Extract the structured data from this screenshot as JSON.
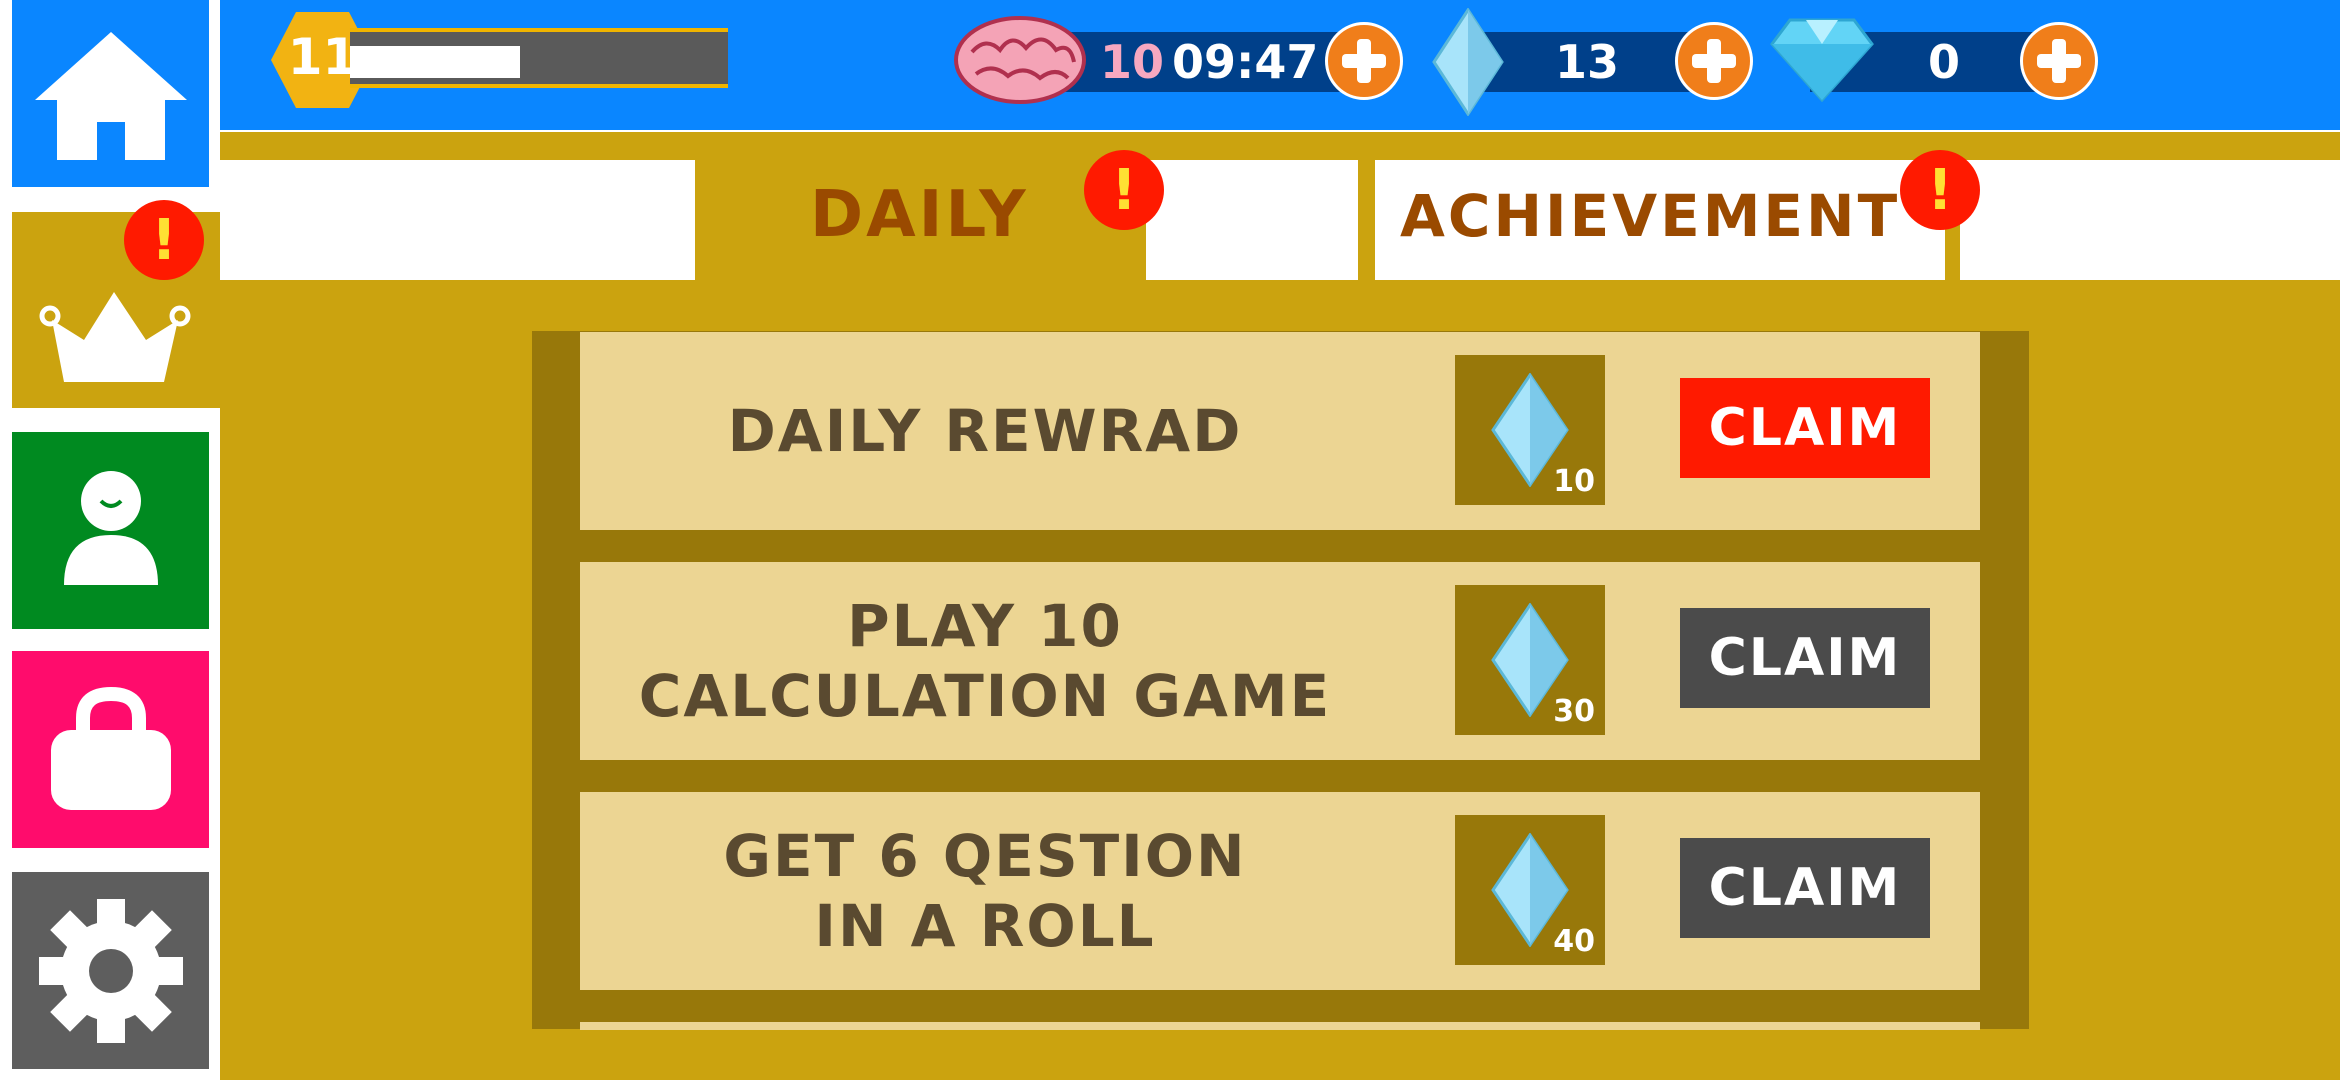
{
  "colors": {
    "top_bar": "#0a86ff",
    "main_gold": "#cba30f",
    "panel_dark_gold": "#98780a",
    "row_cream": "#ecd593",
    "claim_active": "#ff1a00",
    "claim_inactive": "#4b4b4b",
    "alert_red": "#ff1a00",
    "tab_text": "#9a4a00",
    "nav_home": "#0a86ff",
    "nav_profile": "#008a20",
    "nav_shop": "#ff0c6c",
    "nav_settings": "#5e5e5e"
  },
  "header": {
    "level": "11",
    "xp_progress": 0.45,
    "brain_count": "10",
    "timer": "09:47",
    "gem_count": "13",
    "diamond_count": "0"
  },
  "nav": {
    "items": [
      {
        "id": "home",
        "icon": "home-icon"
      },
      {
        "id": "quests",
        "icon": "crown-icon",
        "alert": "!"
      },
      {
        "id": "profile",
        "icon": "person-icon"
      },
      {
        "id": "shop",
        "icon": "bag-icon"
      },
      {
        "id": "settings",
        "icon": "gear-icon"
      }
    ]
  },
  "tabs": [
    {
      "label": "DAILY",
      "alert": "!",
      "active": true
    },
    {
      "label": "ACHIEVEMENT",
      "alert": "!",
      "active": false
    }
  ],
  "quests": [
    {
      "title_lines": [
        "DAILY REWRAD"
      ],
      "reward": "10",
      "reward_icon": "crystal-icon",
      "claim_label": "CLAIM",
      "claimable": true
    },
    {
      "title_lines": [
        "PLAY 10",
        "CALCULATION GAME"
      ],
      "reward": "30",
      "reward_icon": "crystal-icon",
      "claim_label": "CLAIM",
      "claimable": false
    },
    {
      "title_lines": [
        "GET 6 QESTION",
        "IN A ROLL"
      ],
      "reward": "40",
      "reward_icon": "crystal-icon",
      "claim_label": "CLAIM",
      "claimable": false
    }
  ]
}
